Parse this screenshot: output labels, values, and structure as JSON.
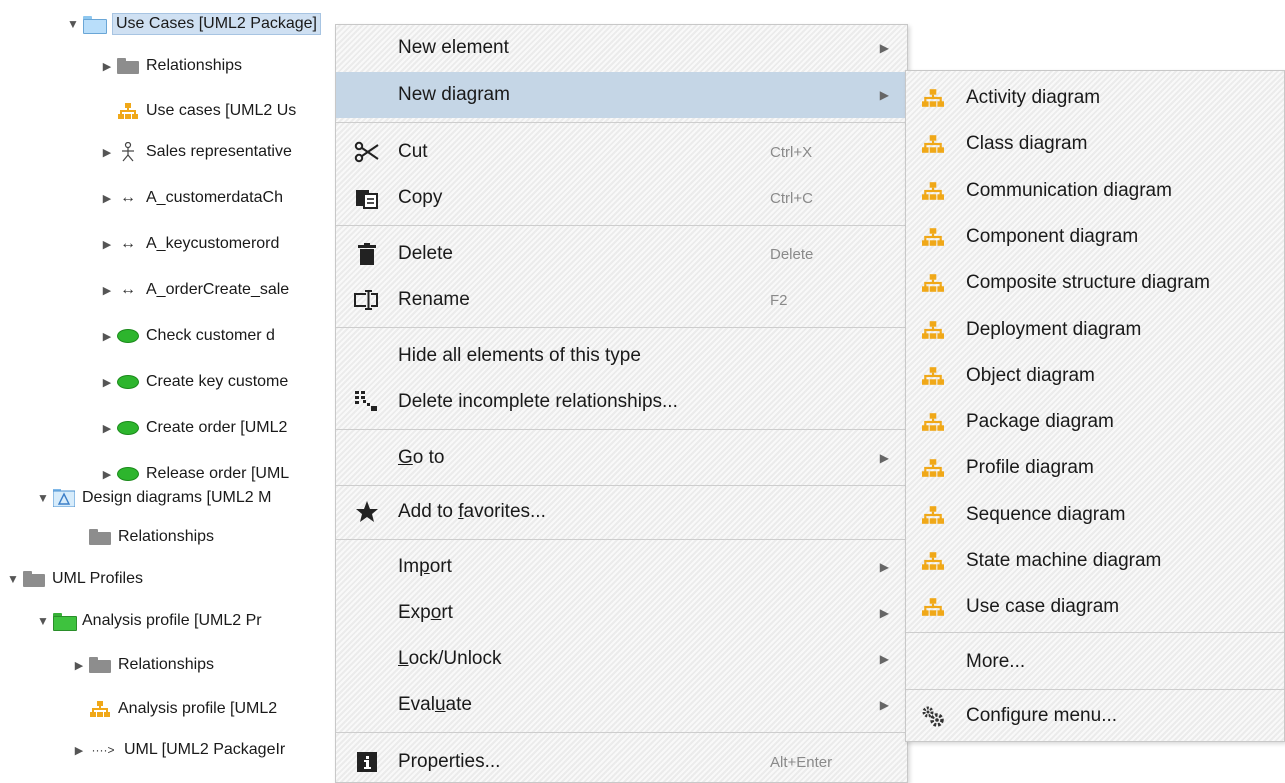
{
  "tree": {
    "items": [
      {
        "label": "Use Cases [UML2 Package]",
        "arrow": "▼",
        "icon": "folder-blue-icon"
      },
      {
        "label": "Relationships",
        "arrow": "▶",
        "icon": "folder-icon"
      },
      {
        "label": "Use cases [UML2 Us",
        "arrow": "",
        "icon": "diagram-icon"
      },
      {
        "label": "Sales representative",
        "arrow": "▶",
        "icon": "actor-icon"
      },
      {
        "label": "A_customerdataCh",
        "arrow": "▶",
        "icon": "association-icon"
      },
      {
        "label": "A_keycustomerord",
        "arrow": "▶",
        "icon": "association-icon"
      },
      {
        "label": "A_orderCreate_sale",
        "arrow": "▶",
        "icon": "association-icon"
      },
      {
        "label": "Check customer  d",
        "arrow": "▶",
        "icon": "use-case-icon"
      },
      {
        "label": "Create key custome",
        "arrow": "▶",
        "icon": "use-case-icon"
      },
      {
        "label": "Create order [UML2",
        "arrow": "▶",
        "icon": "use-case-icon"
      },
      {
        "label": "Release order [UML",
        "arrow": "▶",
        "icon": "use-case-icon"
      },
      {
        "label": "Design diagrams [UML2 M",
        "arrow": "▼",
        "icon": "model-icon"
      },
      {
        "label": "Relationships",
        "arrow": "",
        "icon": "folder-icon"
      },
      {
        "label": "UML Profiles",
        "arrow": "▼",
        "icon": "folder-icon"
      },
      {
        "label": "Analysis profile [UML2 Pr",
        "arrow": "▼",
        "icon": "folder-green-icon"
      },
      {
        "label": "Relationships",
        "arrow": "▶",
        "icon": "folder-icon"
      },
      {
        "label": "Analysis profile [UML2",
        "arrow": "",
        "icon": "diagram-icon"
      },
      {
        "label": "UML [UML2 PackageIr",
        "arrow": "▶",
        "icon": "package-import-icon"
      }
    ],
    "association_glyph": "↔",
    "import_glyph": "····>"
  },
  "context_menu": {
    "items": [
      {
        "label": "New element",
        "key": "",
        "submenu": true
      },
      {
        "label": "New diagram",
        "key": "",
        "submenu": true,
        "highlighted": true
      },
      {
        "label": "Cut",
        "key": "Ctrl+X",
        "icon": "scissors-icon"
      },
      {
        "label": "Copy",
        "key": "Ctrl+C",
        "icon": "copy-icon"
      },
      {
        "label": "Delete",
        "key": "Delete",
        "icon": "trash-icon"
      },
      {
        "label": "Rename",
        "key": "F2",
        "icon": "rename-icon"
      },
      {
        "label": "Hide all elements of this type",
        "key": ""
      },
      {
        "label": "Delete incomplete relationships...",
        "key": "",
        "icon": "relationships-icon"
      },
      {
        "label_pre": "",
        "label_u": "G",
        "label_post": "o to",
        "submenu": true
      },
      {
        "label_pre": "Add to ",
        "label_u": "f",
        "label_post": "avorites...",
        "icon": "star-icon"
      },
      {
        "label_pre": "Im",
        "label_u": "p",
        "label_post": "ort",
        "submenu": true
      },
      {
        "label_pre": "Exp",
        "label_u": "o",
        "label_post": "rt",
        "submenu": true
      },
      {
        "label_pre": "",
        "label_u": "L",
        "label_post": "ock/Unlock",
        "submenu": true
      },
      {
        "label_pre": "Eval",
        "label_u": "u",
        "label_post": "ate",
        "submenu": true
      },
      {
        "label": "Properties...",
        "key": "Alt+Enter",
        "icon": "info-icon"
      }
    ],
    "submenu_glyph": "▶"
  },
  "diagram_submenu": {
    "items": [
      "Activity diagram",
      "Class diagram",
      "Communication diagram",
      "Component diagram",
      "Composite structure diagram",
      "Deployment diagram",
      "Object diagram",
      "Package diagram",
      "Profile diagram",
      "Sequence diagram",
      "State machine diagram",
      "Use case diagram"
    ],
    "more": "More...",
    "configure": "Configure menu..."
  },
  "colors": {
    "highlight": "#c5d6e6",
    "diagram_icon": "#f0a818",
    "use_case_green": "#2db52d"
  }
}
